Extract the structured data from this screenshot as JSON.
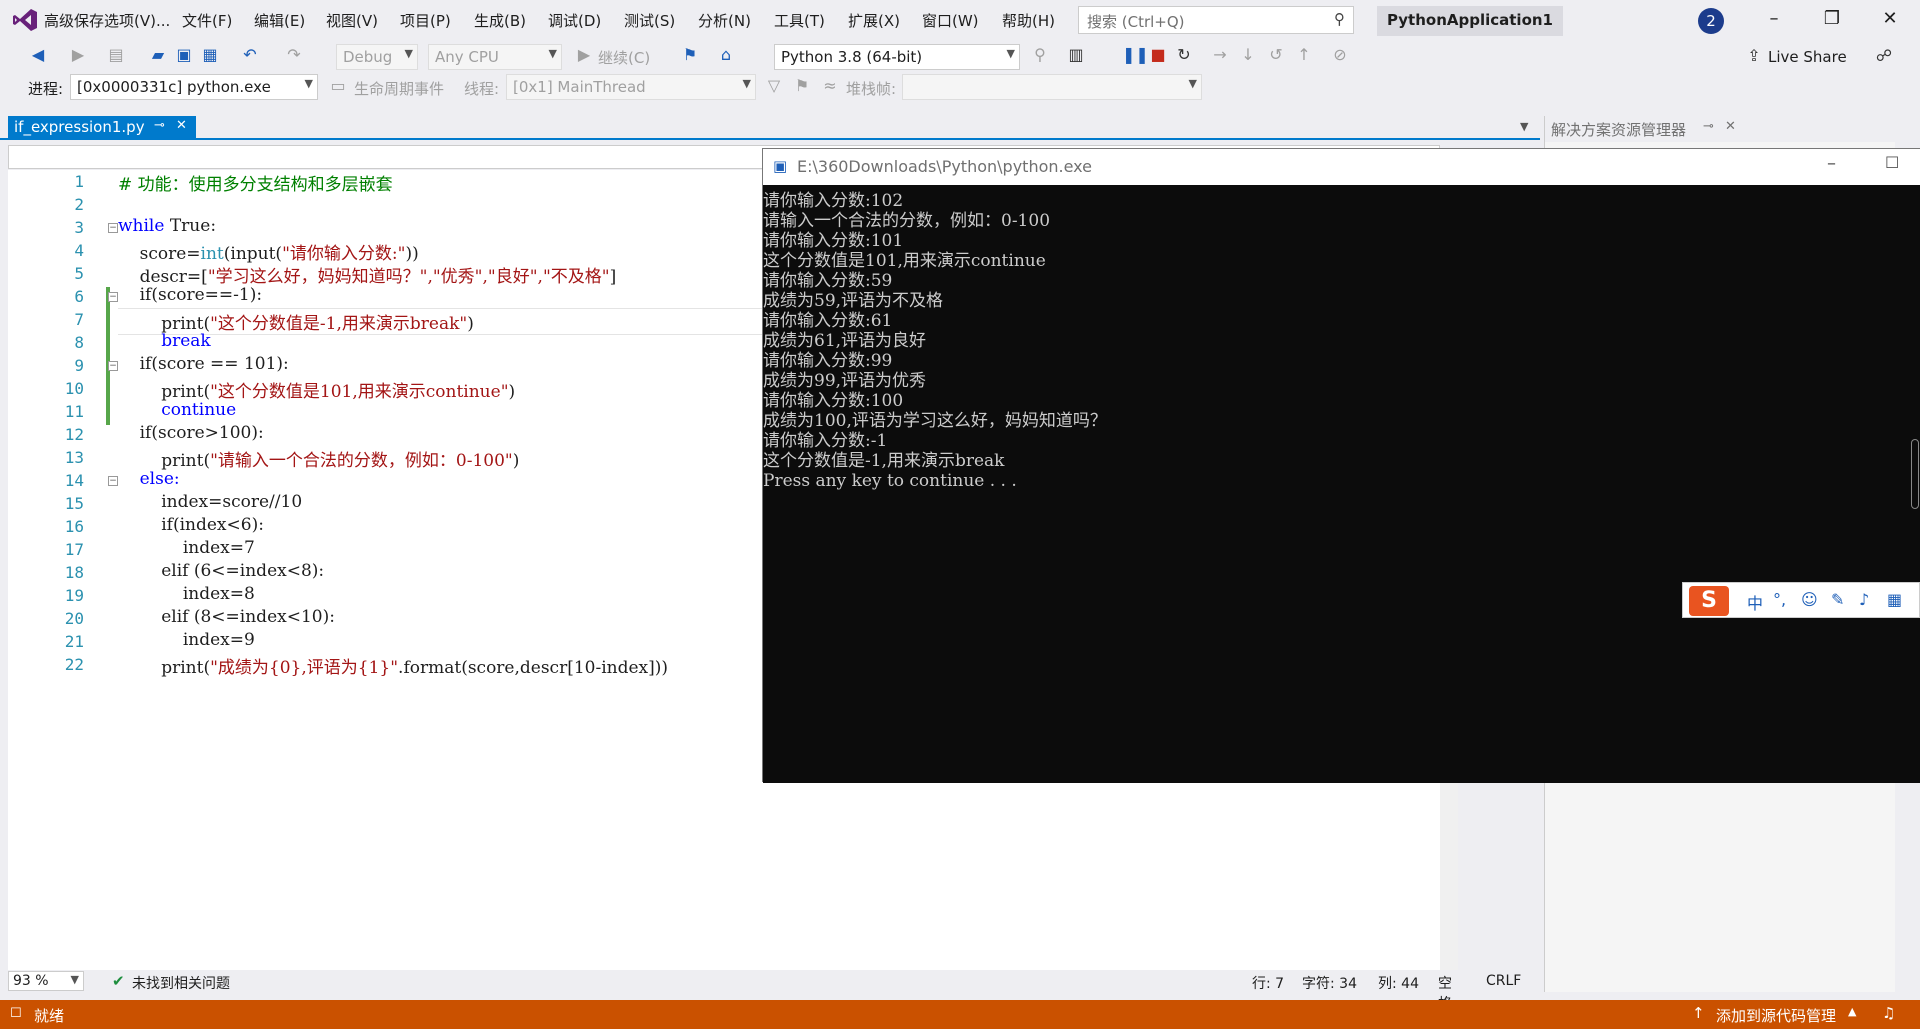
{
  "menu": {
    "items": [
      "高级保存选项(V)...",
      "文件(F)",
      "编辑(E)",
      "视图(V)",
      "项目(P)",
      "生成(B)",
      "调试(D)",
      "测试(S)",
      "分析(N)",
      "工具(T)",
      "扩展(X)",
      "窗口(W)",
      "帮助(H)"
    ],
    "search_placeholder": "搜索 (Ctrl+Q)",
    "project_title": "PythonApplication1",
    "notification_count": "2"
  },
  "toolbar": {
    "config": "Debug",
    "platform": "Any CPU",
    "continue_label": "继续(C)",
    "python_env": "Python 3.8 (64-bit)",
    "live_share": "Live Share",
    "process_label": "进程:",
    "process_value": "[0x0000331c] python.exe",
    "lifecycle_label": "生命周期事件",
    "thread_label": "线程:",
    "thread_value": "[0x1] MainThread",
    "stackframe_label": "堆栈帧:"
  },
  "doc_tab": {
    "filename": "if_expression1.py",
    "pin": "⊸",
    "close": "✕"
  },
  "editor": {
    "lines": [
      {
        "n": "1"
      },
      {
        "n": "2"
      },
      {
        "n": "3"
      },
      {
        "n": "4"
      },
      {
        "n": "5"
      },
      {
        "n": "6"
      },
      {
        "n": "7"
      },
      {
        "n": "8"
      },
      {
        "n": "9"
      },
      {
        "n": "10"
      },
      {
        "n": "11"
      },
      {
        "n": "12"
      },
      {
        "n": "13"
      },
      {
        "n": "14"
      },
      {
        "n": "15"
      },
      {
        "n": "16"
      },
      {
        "n": "17"
      },
      {
        "n": "18"
      },
      {
        "n": "19"
      },
      {
        "n": "20"
      },
      {
        "n": "21"
      },
      {
        "n": "22"
      }
    ],
    "code": {
      "l1": "# 功能：使用多分支结构和多层嵌套",
      "l3_kw": "while",
      "l3_rest": " True:",
      "l4_a": "    score=",
      "l4_fn": "int",
      "l4_b": "(input(",
      "l4_str": "\"请你输入分数:\"",
      "l4_c": "))",
      "l5_a": "    descr=[",
      "l5_str": "\"学习这么好，妈妈知道吗？\",\"优秀\",\"良好\",\"不及格\"",
      "l5_b": "]",
      "l6": "    if(score==-1):",
      "l7_a": "        print(",
      "l7_str": "\"这个分数值是-1,用来演示break\"",
      "l7_b": ")",
      "l8": "        break",
      "l9": "    if(score == 101):",
      "l10_a": "        print(",
      "l10_str": "\"这个分数值是101,用来演示continue\"",
      "l10_b": ")",
      "l11": "        continue",
      "l12": "    if(score>100):",
      "l13_a": "        print(",
      "l13_str": "\"请输入一个合法的分数，例如：0-100\"",
      "l13_b": ")",
      "l14": "    else:",
      "l15": "        index=score//10",
      "l16": "        if(index<6):",
      "l17": "            index=7",
      "l18": "        elif (6<=index<8):",
      "l19": "            index=8",
      "l20": "        elif (8<=index<10):",
      "l21": "            index=9",
      "l22_a": "        print(",
      "l22_str": "\"成绩为{0},评语为{1}\"",
      "l22_b": ".format(score,descr[10-index]))"
    }
  },
  "editor_status": {
    "zoom": "93 %",
    "issues": "未找到相关问题",
    "line": "行: 7",
    "char": "字符: 34",
    "col": "列: 44",
    "spaces": "空格",
    "eol": "CRLF"
  },
  "solution_panel": {
    "title": "解决方案资源管理器"
  },
  "console": {
    "title": "E:\\360Downloads\\Python\\python.exe",
    "lines": [
      "请你输入分数:102",
      "请输入一个合法的分数，例如：0-100",
      "请你输入分数:101",
      "这个分数值是101,用来演示continue",
      "请你输入分数:59",
      "成绩为59,评语为不及格",
      "请你输入分数:61",
      "成绩为61,评语为良好",
      "请你输入分数:99",
      "成绩为99,评语为优秀",
      "请你输入分数:100",
      "成绩为100,评语为学习这么好，妈妈知道吗？",
      "请你输入分数:-1",
      "这个分数值是-1,用来演示break",
      "Press any key to continue . . ."
    ]
  },
  "ime": {
    "logo": "S",
    "lang": "中"
  },
  "statusbar": {
    "ready": "就绪",
    "source_control": "添加到源代码管理"
  }
}
